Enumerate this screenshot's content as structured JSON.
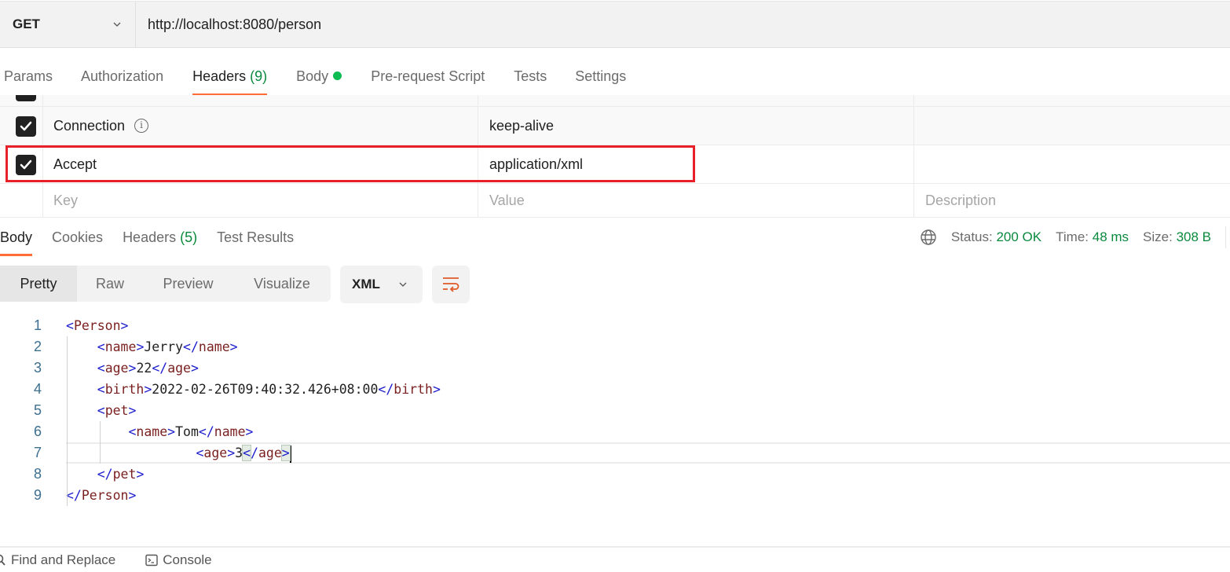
{
  "request": {
    "method": "GET",
    "url": "http://localhost:8080/person"
  },
  "request_tabs": [
    {
      "label": "Params"
    },
    {
      "label": "Authorization"
    },
    {
      "label": "Headers",
      "count": "(9)",
      "active": true
    },
    {
      "label": "Body",
      "indicator": "green-dot"
    },
    {
      "label": "Pre-request Script"
    },
    {
      "label": "Tests"
    },
    {
      "label": "Settings"
    }
  ],
  "headers_table": {
    "rows": [
      {
        "checked": true,
        "key": "Connection",
        "key_icon": "info-icon",
        "value": "keep-alive",
        "description": ""
      },
      {
        "checked": true,
        "key": "Accept",
        "value": "application/xml",
        "description": "",
        "highlighted": true
      }
    ],
    "placeholders": {
      "key": "Key",
      "value": "Value",
      "description": "Description"
    }
  },
  "response_tabs": [
    {
      "label": "Body",
      "active": true
    },
    {
      "label": "Cookies"
    },
    {
      "label": "Headers",
      "count": "(5)"
    },
    {
      "label": "Test Results"
    }
  ],
  "response_status": {
    "status_label": "Status:",
    "status_value": "200 OK",
    "time_label": "Time:",
    "time_value": "48 ms",
    "size_label": "Size:",
    "size_value": "308 B"
  },
  "view_modes": [
    "Pretty",
    "Raw",
    "Preview",
    "Visualize"
  ],
  "active_view_mode": "Pretty",
  "format": "XML",
  "code_lines": [
    {
      "n": "1",
      "indent": 0,
      "open": "Person"
    },
    {
      "n": "2",
      "indent": 1,
      "open": "name",
      "text": "Jerry",
      "close": "name"
    },
    {
      "n": "3",
      "indent": 1,
      "open": "age",
      "text": "22",
      "close": "age"
    },
    {
      "n": "4",
      "indent": 1,
      "open": "birth",
      "text": "2022-02-26T09:40:32.426+08:00",
      "close": "birth"
    },
    {
      "n": "5",
      "indent": 1,
      "open": "pet"
    },
    {
      "n": "6",
      "indent": 2,
      "open": "name",
      "text": "Tom",
      "close": "name"
    },
    {
      "n": "7",
      "indent": 2,
      "open": "age",
      "text": "3",
      "close": "age",
      "current": true
    },
    {
      "n": "8",
      "indent": 1,
      "close_only": "pet"
    },
    {
      "n": "9",
      "indent": 0,
      "close_only": "Person"
    }
  ],
  "footer": {
    "find_replace": "Find and Replace",
    "console": "Console"
  },
  "colors": {
    "accent": "#ff6c37",
    "success": "#0b8a3e",
    "highlight_border": "#e8202a",
    "body_dot": "#0cbb52"
  }
}
